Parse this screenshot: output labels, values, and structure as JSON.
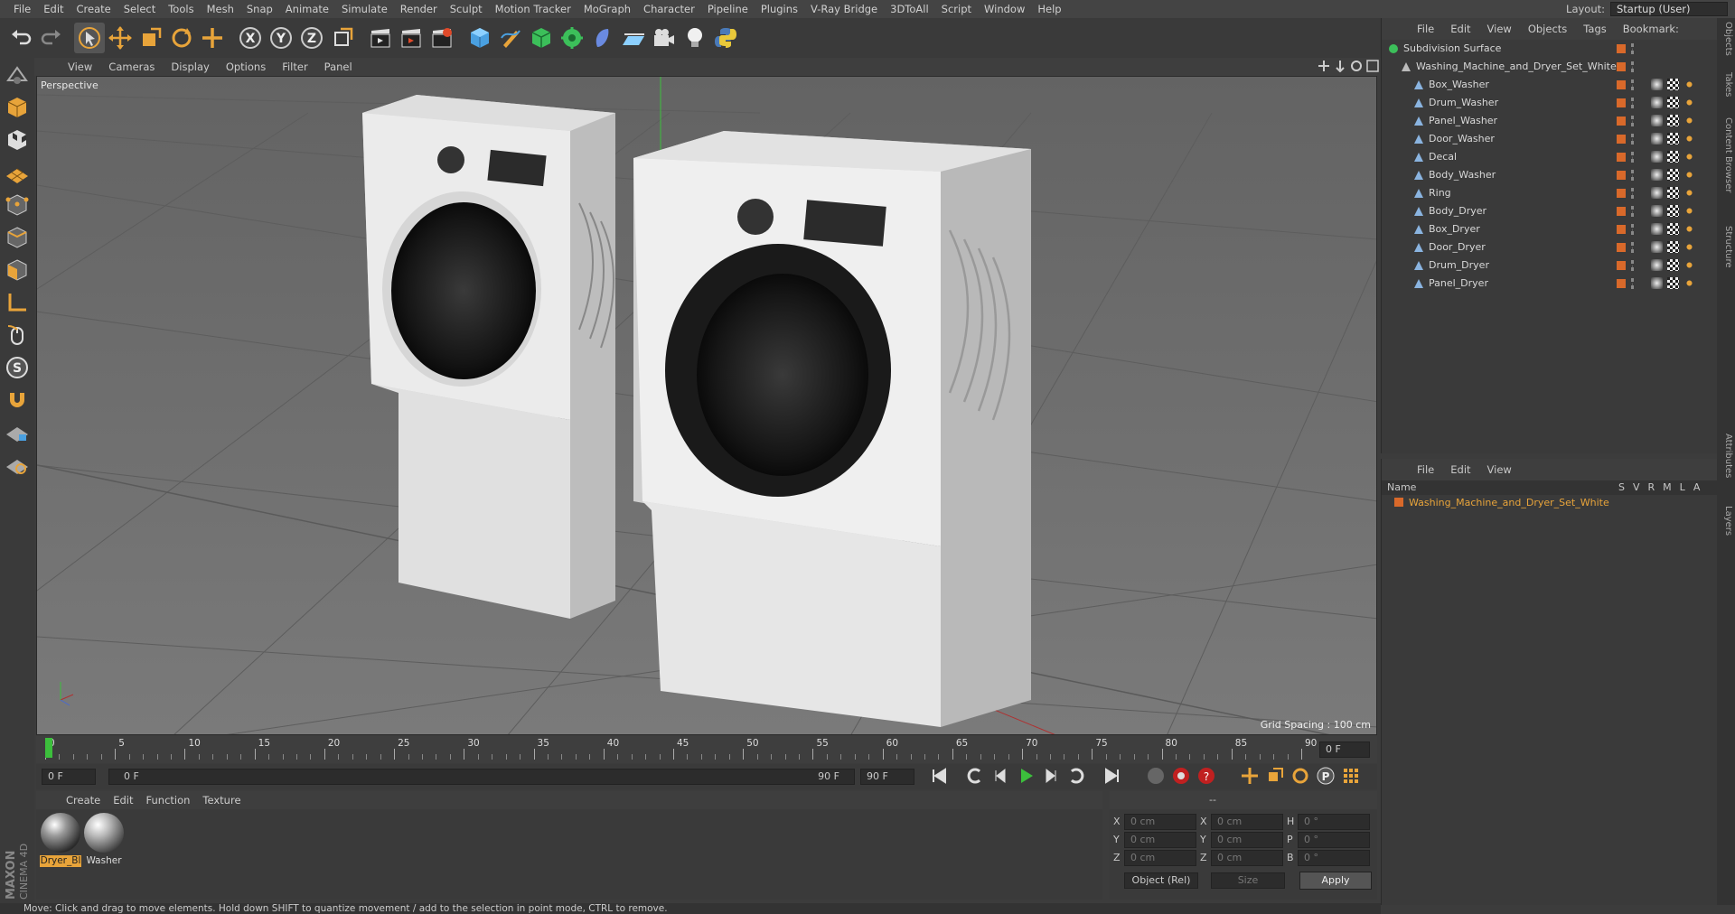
{
  "menubar": {
    "items": [
      "File",
      "Edit",
      "Create",
      "Select",
      "Tools",
      "Mesh",
      "Snap",
      "Animate",
      "Simulate",
      "Render",
      "Sculpt",
      "Motion Tracker",
      "MoGraph",
      "Character",
      "Pipeline",
      "Plugins",
      "V-Ray Bridge",
      "3DToAll",
      "Script",
      "Window",
      "Help"
    ],
    "layout_label": "Layout:",
    "layout_value": "Startup (User)"
  },
  "viewport": {
    "menu": [
      "View",
      "Cameras",
      "Display",
      "Options",
      "Filter",
      "Panel"
    ],
    "label": "Perspective",
    "grid_spacing": "Grid Spacing : 100 cm"
  },
  "timeline": {
    "ticks": [
      "0",
      "5",
      "10",
      "15",
      "20",
      "25",
      "30",
      "35",
      "40",
      "45",
      "50",
      "55",
      "60",
      "65",
      "70",
      "75",
      "80",
      "85",
      "90"
    ],
    "current_frame": "0 F",
    "start_field": "0 F",
    "range_start": "0 F",
    "range_end": "90 F",
    "end_field": "90 F"
  },
  "materials": {
    "menu": [
      "Create",
      "Edit",
      "Function",
      "Texture"
    ],
    "items": [
      {
        "name": "Dryer_Bl",
        "selected": true
      },
      {
        "name": "Washer",
        "selected": false
      }
    ]
  },
  "coords": {
    "headers": [
      "--",
      "--",
      "--"
    ],
    "rows": [
      {
        "a": "X",
        "av": "0 cm",
        "b": "X",
        "bv": "0 cm",
        "c": "H",
        "cv": "0 °"
      },
      {
        "a": "Y",
        "av": "0 cm",
        "b": "Y",
        "bv": "0 cm",
        "c": "P",
        "cv": "0 °"
      },
      {
        "a": "Z",
        "av": "0 cm",
        "b": "Z",
        "bv": "0 cm",
        "c": "B",
        "cv": "0 °"
      }
    ],
    "mode": "Object (Rel)",
    "size": "Size",
    "apply": "Apply"
  },
  "objects": {
    "menu": [
      "File",
      "Edit",
      "View",
      "Objects",
      "Tags",
      "Bookmark:"
    ],
    "root": "Subdivision Surface",
    "group": "Washing_Machine_and_Dryer_Set_White",
    "children": [
      "Box_Washer",
      "Drum_Washer",
      "Panel_Washer",
      "Door_Washer",
      "Decal",
      "Body_Washer",
      "Ring",
      "Body_Dryer",
      "Box_Dryer",
      "Door_Dryer",
      "Drum_Dryer",
      "Panel_Dryer"
    ]
  },
  "layers": {
    "menu": [
      "File",
      "Edit",
      "View"
    ],
    "col_name": "Name",
    "cols": [
      "S",
      "V",
      "R",
      "M",
      "L",
      "A"
    ],
    "row": "Washing_Machine_and_Dryer_Set_White"
  },
  "sidetabs": [
    "Objects",
    "Takes",
    "Content Browser",
    "Structure",
    "Attributes",
    "Layers"
  ],
  "status": "Move: Click and drag to move elements. Hold down SHIFT to quantize movement / add to the selection in point mode, CTRL to remove.",
  "brand": "MAXON CINEMA 4D",
  "colors": {
    "accent": "#e8a43a",
    "orange_tag": "#d9692a",
    "play": "#3cbf3c"
  }
}
